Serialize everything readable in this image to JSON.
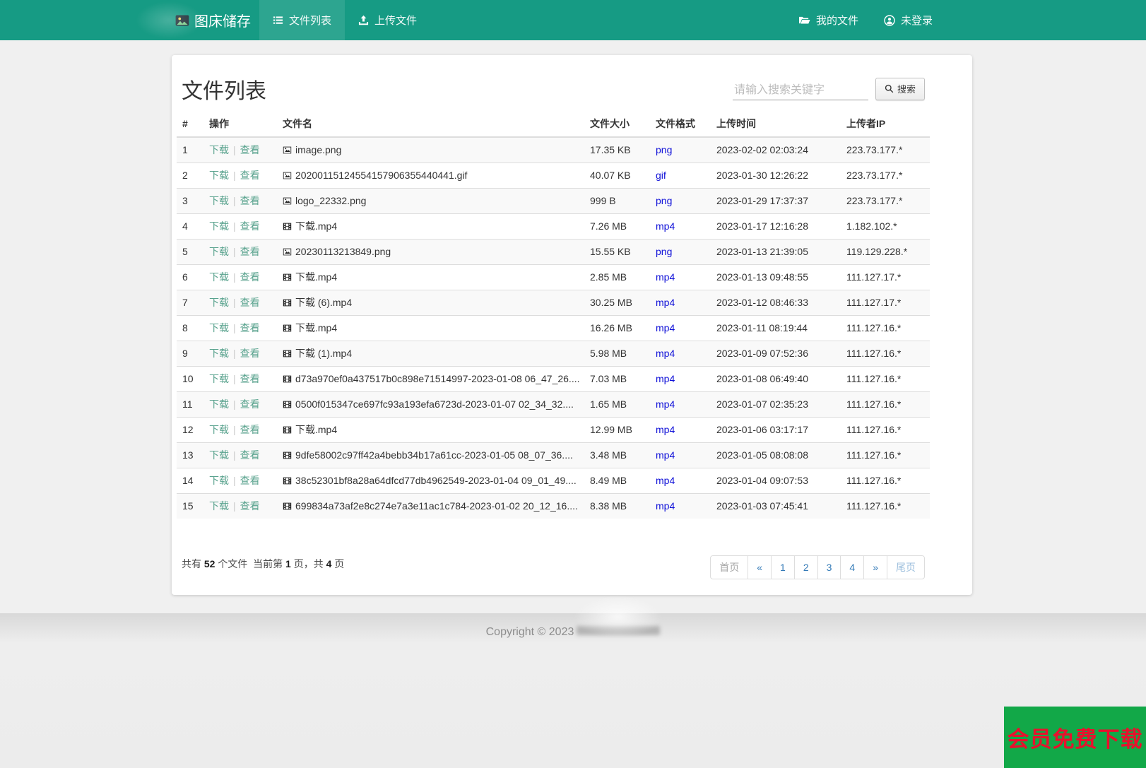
{
  "navbar": {
    "brand": "图床储存",
    "items": [
      {
        "label": "文件列表",
        "active": true
      },
      {
        "label": "上传文件",
        "active": false
      }
    ],
    "right_items": [
      {
        "label": "我的文件"
      },
      {
        "label": "未登录"
      }
    ]
  },
  "page": {
    "title": "文件列表"
  },
  "search": {
    "placeholder": "请输入搜索关键字",
    "button": "搜索"
  },
  "table": {
    "headers": [
      "#",
      "操作",
      "文件名",
      "文件大小",
      "文件格式",
      "上传时间",
      "上传者IP"
    ],
    "action_download": "下载",
    "action_separator": "|",
    "action_view": "查看",
    "rows": [
      {
        "index": "1",
        "icon": "image-icon",
        "name": "image.png",
        "size": "17.35 KB",
        "format": "png",
        "time": "2023-02-02 02:03:24",
        "ip": "223.73.177.*"
      },
      {
        "index": "2",
        "icon": "image-icon",
        "name": "20200115124554157906355440441.gif",
        "size": "40.07 KB",
        "format": "gif",
        "time": "2023-01-30 12:26:22",
        "ip": "223.73.177.*"
      },
      {
        "index": "3",
        "icon": "image-icon",
        "name": "logo_22332.png",
        "size": "999 B",
        "format": "png",
        "time": "2023-01-29 17:37:37",
        "ip": "223.73.177.*"
      },
      {
        "index": "4",
        "icon": "film-icon",
        "name": "下载.mp4",
        "size": "7.26 MB",
        "format": "mp4",
        "time": "2023-01-17 12:16:28",
        "ip": "1.182.102.*"
      },
      {
        "index": "5",
        "icon": "image-icon",
        "name": "20230113213849.png",
        "size": "15.55 KB",
        "format": "png",
        "time": "2023-01-13 21:39:05",
        "ip": "119.129.228.*"
      },
      {
        "index": "6",
        "icon": "film-icon",
        "name": "下载.mp4",
        "size": "2.85 MB",
        "format": "mp4",
        "time": "2023-01-13 09:48:55",
        "ip": "111.127.17.*"
      },
      {
        "index": "7",
        "icon": "film-icon",
        "name": "下载 (6).mp4",
        "size": "30.25 MB",
        "format": "mp4",
        "time": "2023-01-12 08:46:33",
        "ip": "111.127.17.*"
      },
      {
        "index": "8",
        "icon": "film-icon",
        "name": "下载.mp4",
        "size": "16.26 MB",
        "format": "mp4",
        "time": "2023-01-11 08:19:44",
        "ip": "111.127.16.*"
      },
      {
        "index": "9",
        "icon": "film-icon",
        "name": "下载 (1).mp4",
        "size": "5.98 MB",
        "format": "mp4",
        "time": "2023-01-09 07:52:36",
        "ip": "111.127.16.*"
      },
      {
        "index": "10",
        "icon": "film-icon",
        "name": "d73a970ef0a437517b0c898e71514997-2023-01-08 06_47_26....",
        "size": "7.03 MB",
        "format": "mp4",
        "time": "2023-01-08 06:49:40",
        "ip": "111.127.16.*"
      },
      {
        "index": "11",
        "icon": "film-icon",
        "name": "0500f015347ce697fc93a193efa6723d-2023-01-07 02_34_32....",
        "size": "1.65 MB",
        "format": "mp4",
        "time": "2023-01-07 02:35:23",
        "ip": "111.127.16.*"
      },
      {
        "index": "12",
        "icon": "film-icon",
        "name": "下载.mp4",
        "size": "12.99 MB",
        "format": "mp4",
        "time": "2023-01-06 03:17:17",
        "ip": "111.127.16.*"
      },
      {
        "index": "13",
        "icon": "film-icon",
        "name": "9dfe58002c97ff42a4bebb34b17a61cc-2023-01-05 08_07_36....",
        "size": "3.48 MB",
        "format": "mp4",
        "time": "2023-01-05 08:08:08",
        "ip": "111.127.16.*"
      },
      {
        "index": "14",
        "icon": "film-icon",
        "name": "38c52301bf8a28a64dfcd77db4962549-2023-01-04 09_01_49....",
        "size": "8.49 MB",
        "format": "mp4",
        "time": "2023-01-04 09:07:53",
        "ip": "111.127.16.*"
      },
      {
        "index": "15",
        "icon": "film-icon",
        "name": "699834a73af2e8c274e7a3e11ac1c784-2023-01-02 20_12_16....",
        "size": "8.38 MB",
        "format": "mp4",
        "time": "2023-01-03 07:45:41",
        "ip": "111.127.16.*"
      }
    ]
  },
  "pagination": {
    "summary": {
      "prefix": "共有",
      "total_files": "52",
      "files_label": "个文件",
      "current_prefix": "当前第",
      "current_page": "1",
      "current_mid": "页，共",
      "total_pages": "4",
      "pages_label": "页"
    },
    "buttons": [
      {
        "key": "first",
        "label": "首页",
        "style": "muted"
      },
      {
        "key": "prev",
        "label": "«"
      },
      {
        "key": "page-1",
        "label": "1"
      },
      {
        "key": "page-2",
        "label": "2"
      },
      {
        "key": "page-3",
        "label": "3"
      },
      {
        "key": "page-4",
        "label": "4"
      },
      {
        "key": "next",
        "label": "»"
      },
      {
        "key": "last",
        "label": "尾页",
        "style": "soft"
      }
    ]
  },
  "footer": {
    "copyright": "Copyright © 2023"
  },
  "badge": {
    "text": "会员免费下载",
    "bg": "#12a848",
    "color": "#e8112d"
  },
  "colors": {
    "navbar_bg": "#169b84",
    "navbar_active_bg": "#2aa893",
    "action_link": "#58a28d",
    "format_link": "#0f10d8",
    "pagination_link": "#337ab7",
    "row_stripe": "#f9f9f9"
  }
}
